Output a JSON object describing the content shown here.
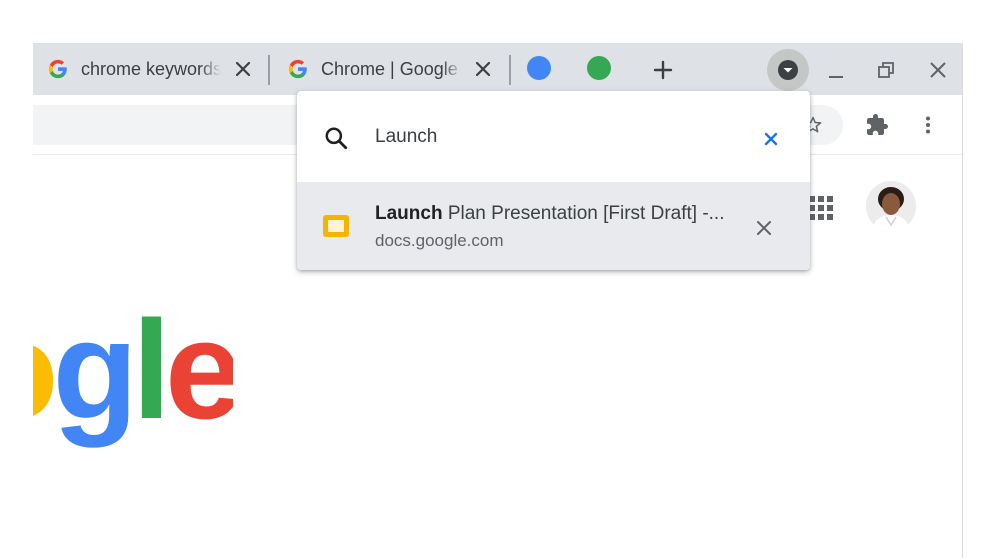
{
  "tabs": [
    {
      "title": "chrome keywords",
      "icon": "google-g-icon"
    },
    {
      "title": "Chrome | Google",
      "icon": "google-g-icon"
    }
  ],
  "tab_groups": [
    {
      "color": "#4285f4"
    },
    {
      "color": "#34a853"
    }
  ],
  "tab_search": {
    "query": "Launch",
    "results": [
      {
        "title_match": "Launch",
        "title_rest": " Plan Presentation [First Draft] -...",
        "url": "docs.google.com",
        "icon": "google-slides-icon"
      }
    ]
  },
  "logo": {
    "text": "ogle",
    "colors": [
      "#fbbc05",
      "#4285f4",
      "#34a853",
      "#ea4335"
    ]
  },
  "colors": {
    "tabstrip": "#dee1e6",
    "accent_close": "#1a73e8"
  }
}
